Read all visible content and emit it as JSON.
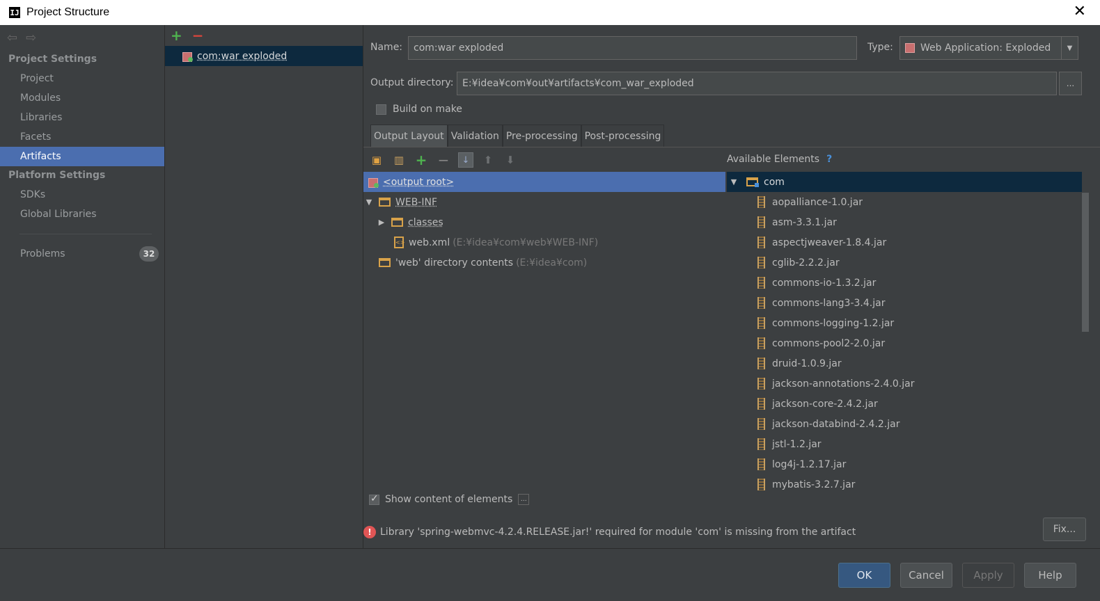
{
  "window": {
    "title": "Project Structure",
    "close_glyph": "✕"
  },
  "sidebar": {
    "sections": [
      {
        "title": "Project Settings",
        "items": [
          "Project",
          "Modules",
          "Libraries",
          "Facets",
          "Artifacts"
        ]
      },
      {
        "title": "Platform Settings",
        "items": [
          "SDKs",
          "Global Libraries"
        ]
      }
    ],
    "selected": "Artifacts",
    "problems": {
      "label": "Problems",
      "count": "32"
    }
  },
  "artifacts": {
    "items": [
      "com:war exploded"
    ]
  },
  "form": {
    "name_label": "Name:",
    "name_value": "com:war exploded",
    "type_label": "Type:",
    "type_value": "Web Application: Exploded",
    "outdir_label": "Output directory:",
    "outdir_value": "E:¥idea¥com¥out¥artifacts¥com_war_exploded",
    "browse_label": "...",
    "build_on_make": "Build on make"
  },
  "tabs": [
    "Output Layout",
    "Validation",
    "Pre-processing",
    "Post-processing"
  ],
  "layout_tree": [
    {
      "label": "<output root>",
      "hint": ""
    },
    {
      "label": "WEB-INF",
      "hint": ""
    },
    {
      "label": "classes",
      "hint": ""
    },
    {
      "label": "web.xml",
      "hint": "(E:¥idea¥com¥web¥WEB-INF)"
    },
    {
      "label": "'web' directory contents",
      "hint": "(E:¥idea¥com)"
    }
  ],
  "available": {
    "title": "Available Elements",
    "help": "?",
    "root": "com",
    "jars": [
      "aopalliance-1.0.jar",
      "asm-3.3.1.jar",
      "aspectjweaver-1.8.4.jar",
      "cglib-2.2.2.jar",
      "commons-io-1.3.2.jar",
      "commons-lang3-3.4.jar",
      "commons-logging-1.2.jar",
      "commons-pool2-2.0.jar",
      "druid-1.0.9.jar",
      "jackson-annotations-2.4.0.jar",
      "jackson-core-2.4.2.jar",
      "jackson-databind-2.4.2.jar",
      "jstl-1.2.jar",
      "log4j-1.2.17.jar",
      "mybatis-3.2.7.jar"
    ]
  },
  "show_content": "Show content of elements",
  "error": {
    "message": "Library 'spring-webmvc-4.2.4.RELEASE.jar!' required for module 'com' is missing from the artifact",
    "fix_label": "Fix..."
  },
  "buttons": {
    "ok": "OK",
    "cancel": "Cancel",
    "apply": "Apply",
    "help": "Help"
  }
}
